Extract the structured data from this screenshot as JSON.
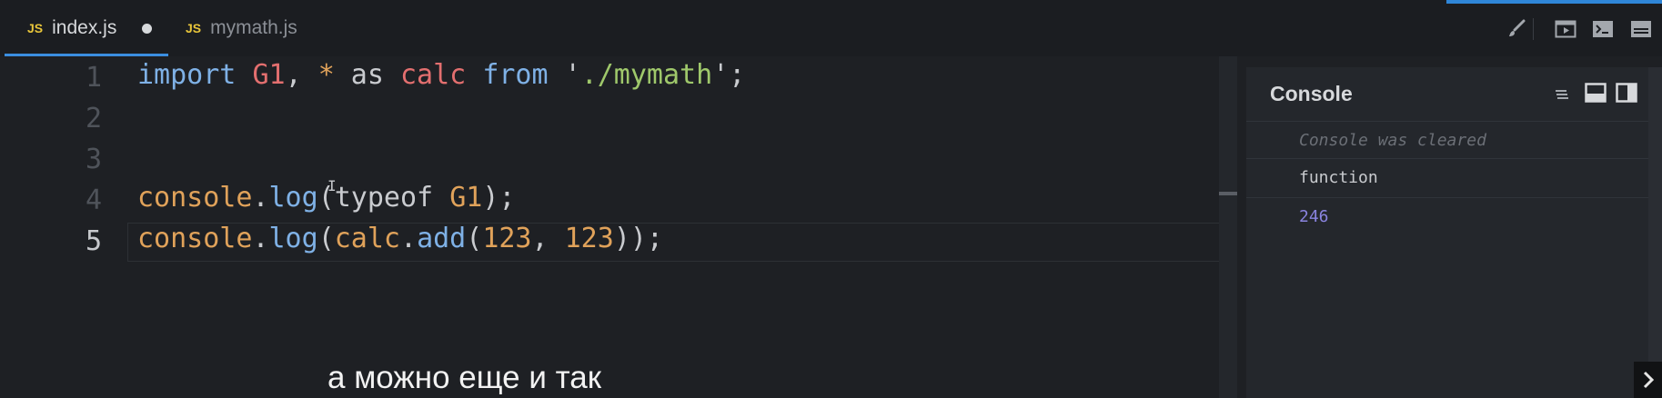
{
  "tabs": [
    {
      "badge": "JS",
      "label": "index.js",
      "active": true,
      "dirty": true
    },
    {
      "badge": "JS",
      "label": "mymath.js",
      "active": false,
      "dirty": false
    }
  ],
  "toolbar": {
    "icons": [
      "brush-icon",
      "preview-icon",
      "terminal-icon",
      "layout-icon"
    ]
  },
  "editor": {
    "line_numbers": [
      "1",
      "2",
      "3",
      "4",
      "5"
    ],
    "current_line": "5",
    "lines": [
      [
        {
          "t": "import",
          "c": "kw"
        },
        {
          "t": " ",
          "c": ""
        },
        {
          "t": "G1",
          "c": "id"
        },
        {
          "t": ", ",
          "c": ""
        },
        {
          "t": "*",
          "c": "op"
        },
        {
          "t": " as ",
          "c": ""
        },
        {
          "t": "calc",
          "c": "id"
        },
        {
          "t": " ",
          "c": ""
        },
        {
          "t": "from",
          "c": "kw"
        },
        {
          "t": " '",
          "c": ""
        },
        {
          "t": "./mymath",
          "c": "str"
        },
        {
          "t": "';",
          "c": ""
        }
      ],
      [],
      [],
      [
        {
          "t": "console",
          "c": "cls"
        },
        {
          "t": ".",
          "c": ""
        },
        {
          "t": "log",
          "c": "fn"
        },
        {
          "t": "(typeof ",
          "c": ""
        },
        {
          "t": "G1",
          "c": "cls"
        },
        {
          "t": ");",
          "c": ""
        }
      ],
      [
        {
          "t": "console",
          "c": "cls"
        },
        {
          "t": ".",
          "c": ""
        },
        {
          "t": "log",
          "c": "fn"
        },
        {
          "t": "(",
          "c": ""
        },
        {
          "t": "calc",
          "c": "cls"
        },
        {
          "t": ".",
          "c": ""
        },
        {
          "t": "add",
          "c": "fn"
        },
        {
          "t": "(",
          "c": ""
        },
        {
          "t": "123",
          "c": "num"
        },
        {
          "t": ", ",
          "c": ""
        },
        {
          "t": "123",
          "c": "num"
        },
        {
          "t": "));",
          "c": ""
        }
      ]
    ]
  },
  "subtitle": "а можно еще и так",
  "console": {
    "title": "Console",
    "rows": [
      {
        "text": "Console was cleared",
        "kind": "cleared"
      },
      {
        "text": "function",
        "kind": "out-str"
      },
      {
        "text": "246",
        "kind": "out-num"
      }
    ]
  },
  "colors": {
    "accent": "#3b8ee0",
    "js_badge": "#e8c53a",
    "keyword": "#7fb1e6",
    "identifier": "#e36f6f",
    "string": "#9fc86b",
    "number": "#e0a25a",
    "console_number": "#8a84e0"
  }
}
